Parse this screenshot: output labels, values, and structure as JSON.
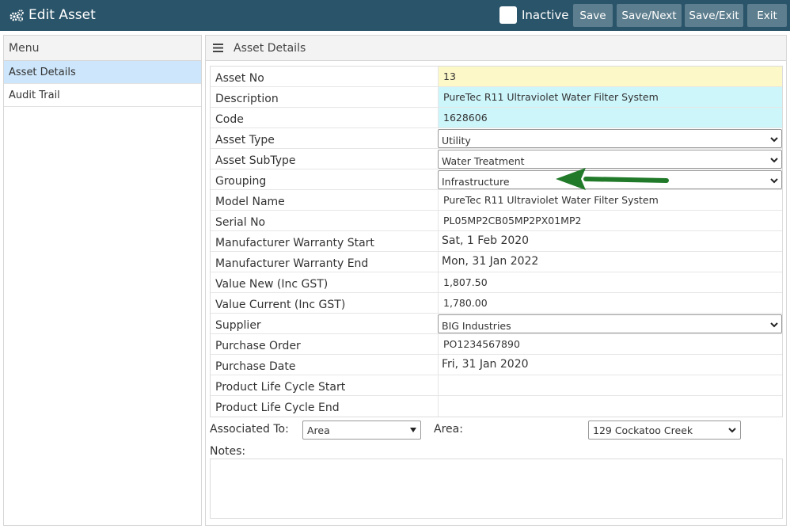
{
  "header": {
    "title": "Edit Asset",
    "icon": "cogs-icon",
    "inactive_label": "Inactive",
    "buttons": {
      "save": "Save",
      "save_next": "Save/Next",
      "save_exit": "Save/Exit",
      "exit": "Exit"
    },
    "bar_color": "#2a5469",
    "button_color": "#5d7e8e"
  },
  "menu": {
    "title": "Menu",
    "items": [
      {
        "label": "Asset Details",
        "active": true
      },
      {
        "label": "Audit Trail",
        "active": false
      }
    ]
  },
  "details": {
    "title": "Asset Details",
    "fields": {
      "asset_no": {
        "label": "Asset No",
        "value": "13"
      },
      "description": {
        "label": "Description",
        "value": "PureTec R11 Ultraviolet Water Filter System"
      },
      "code": {
        "label": "Code",
        "value": "1628606"
      },
      "asset_type": {
        "label": "Asset Type",
        "value": "Utility"
      },
      "asset_subtype": {
        "label": "Asset SubType",
        "value": "Water Treatment"
      },
      "grouping": {
        "label": "Grouping",
        "value": "Infrastructure"
      },
      "model_name": {
        "label": "Model Name",
        "value": "PureTec R11 Ultraviolet Water Filter System"
      },
      "serial_no": {
        "label": "Serial No",
        "value": "PL05MP2CB05MP2PX01MP2"
      },
      "warranty_start": {
        "label": "Manufacturer Warranty Start",
        "value": "Sat, 1 Feb 2020"
      },
      "warranty_end": {
        "label": "Manufacturer Warranty End",
        "value": "Mon, 31 Jan 2022"
      },
      "value_new": {
        "label": "Value New (Inc GST)",
        "value": "1,807.50"
      },
      "value_current": {
        "label": "Value Current (Inc GST)",
        "value": "1,780.00"
      },
      "supplier": {
        "label": "Supplier",
        "value": "BIG Industries"
      },
      "purchase_order": {
        "label": "Purchase Order",
        "value": "PO1234567890"
      },
      "purchase_date": {
        "label": "Purchase Date",
        "value": "Fri, 31 Jan 2020"
      },
      "plc_start": {
        "label": "Product Life Cycle Start",
        "value": ""
      },
      "plc_end": {
        "label": "Product Life Cycle End",
        "value": ""
      }
    },
    "associated_to": {
      "label": "Associated To:",
      "value": "Area"
    },
    "area": {
      "label": "Area:",
      "value": "129 Cockatoo Creek"
    },
    "notes": {
      "label": "Notes:",
      "value": ""
    }
  },
  "colors": {
    "readonly_yellow": "#fdf8c8",
    "readonly_cyan": "#cdf6fb",
    "menu_active": "#cde6fb",
    "annotation_arrow": "#217a2a"
  }
}
